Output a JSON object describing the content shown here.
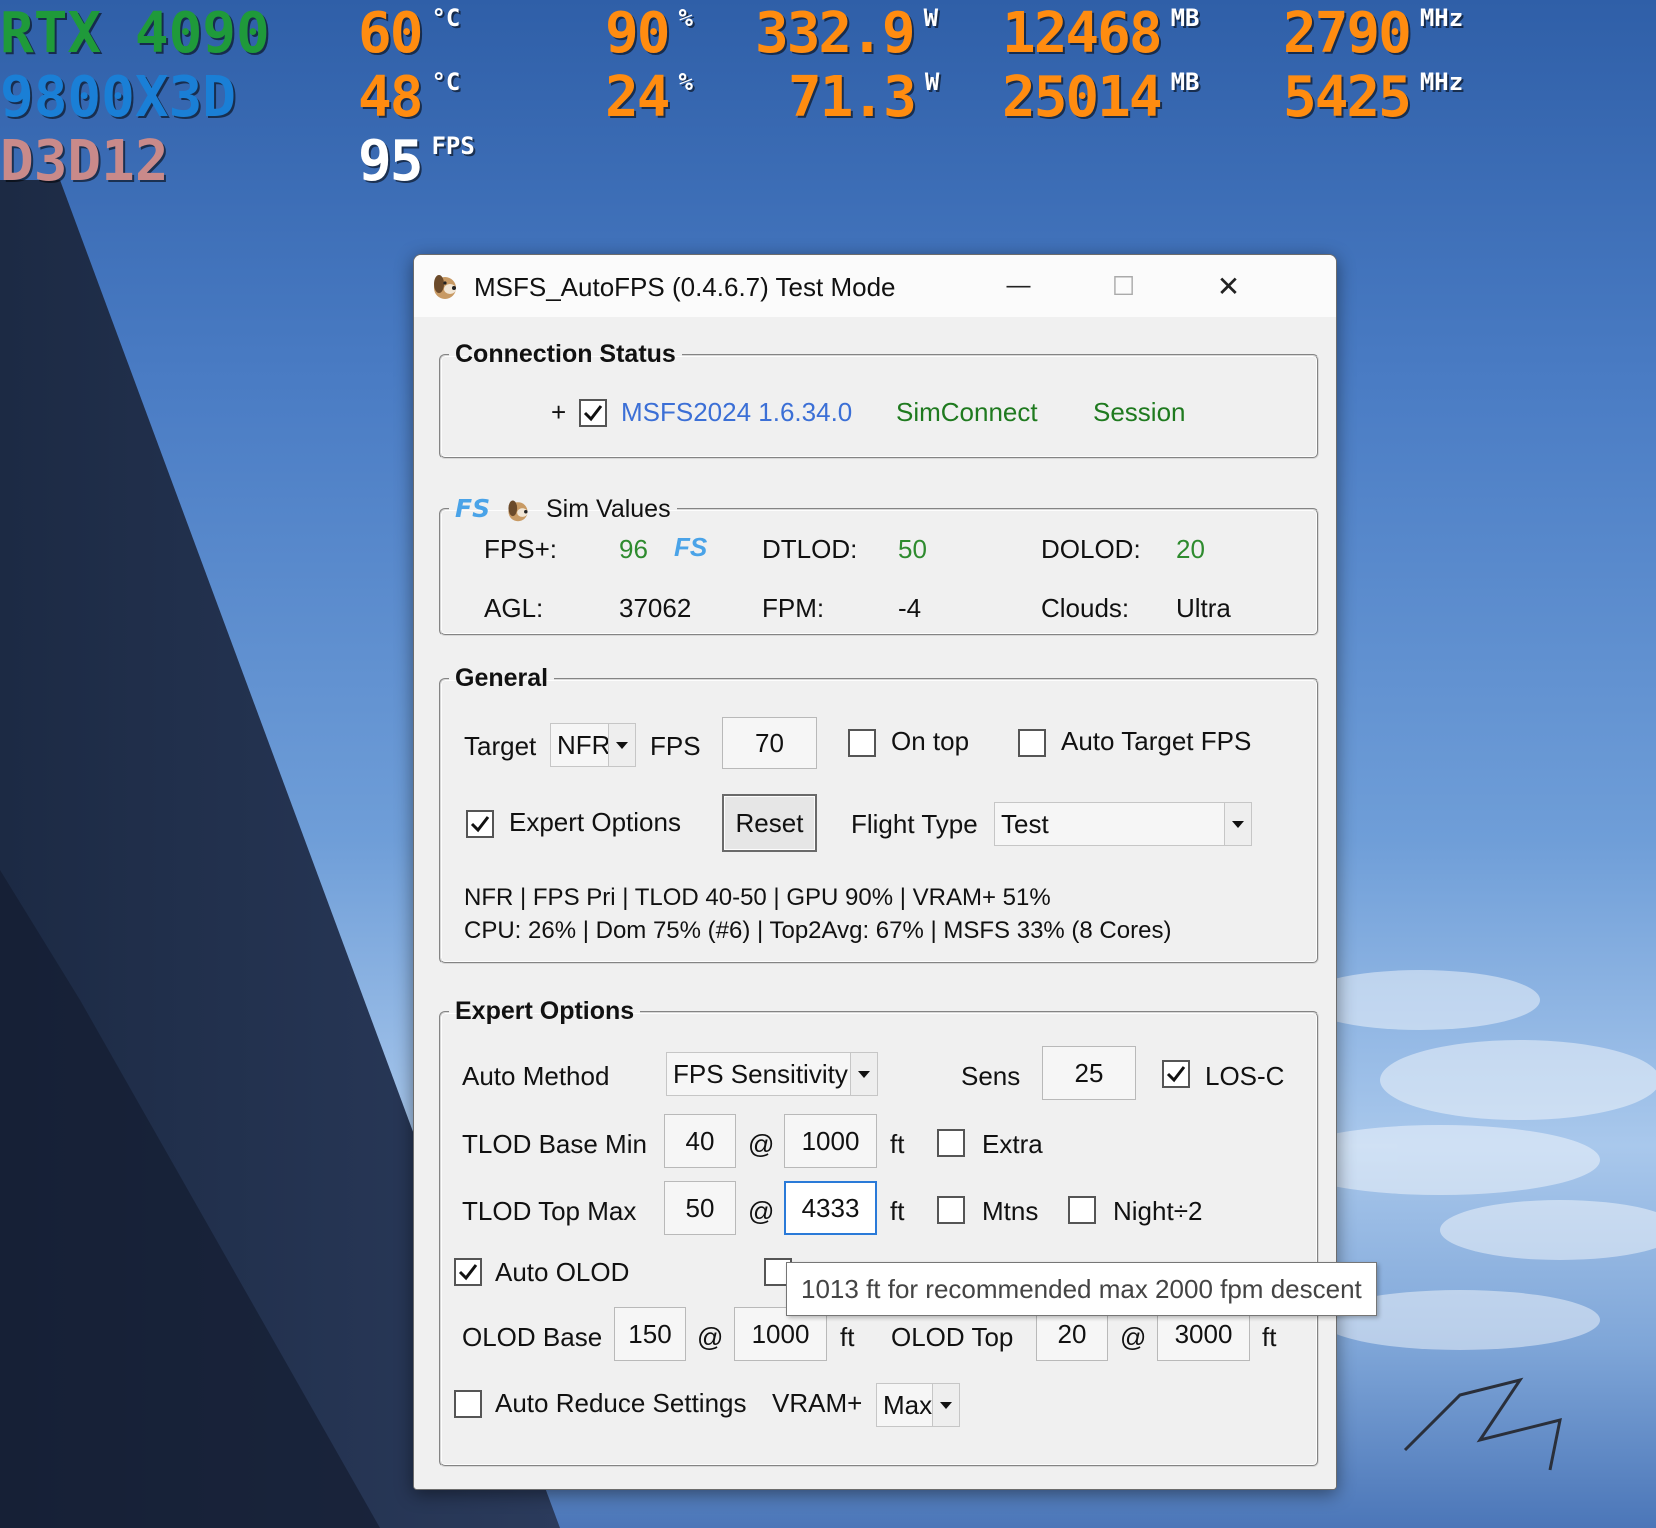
{
  "osd": {
    "gpu_name": "RTX 4090",
    "cpu_name": "9800X3D",
    "api_name": "D3D12",
    "gpu": {
      "temp": "60",
      "temp_unit": "°C",
      "load": "90",
      "load_unit": "%",
      "power": "332.9",
      "power_unit": "W",
      "mem": "12468",
      "mem_unit": "MB",
      "clock": "2790",
      "clock_unit": "MHz"
    },
    "cpu": {
      "temp": "48",
      "temp_unit": "°C",
      "load": "24",
      "load_unit": "%",
      "power": "71.3",
      "power_unit": "W",
      "mem": "25014",
      "mem_unit": "MB",
      "clock": "5425",
      "clock_unit": "MHz"
    },
    "fps": {
      "value": "95",
      "unit": "FPS"
    },
    "colors": {
      "gpu": "#1f9a3a",
      "cpu": "#1a7fd6",
      "api": "#c98a8a",
      "values": "#ff8c10",
      "fps": "#ffffff"
    }
  },
  "window": {
    "title": "MSFS_AutoFPS (0.4.6.7) Test Mode",
    "minimize": "—",
    "maximize": "☐",
    "close": "✕"
  },
  "connection": {
    "legend": "Connection Status",
    "plus": "+",
    "sim_checked": true,
    "sim_version": "MSFS2024 1.6.34.0",
    "simconnect": "SimConnect",
    "session": "Session"
  },
  "sim_values": {
    "legend": "Sim Values",
    "fps_label": "FPS+:",
    "fps_value": "96",
    "dtlod_label": "DTLOD:",
    "dtlod_value": "50",
    "dolod_label": "DOLOD:",
    "dolod_value": "20",
    "agl_label": "AGL:",
    "agl_value": "37062",
    "fpm_label": "FPM:",
    "fpm_value": "-4",
    "clouds_label": "Clouds:",
    "clouds_value": "Ultra"
  },
  "general": {
    "legend": "General",
    "target_label": "Target",
    "target_value": "NFR",
    "fps_label": "FPS",
    "fps_value": "70",
    "on_top_label": "On top",
    "on_top_checked": false,
    "auto_target_label": "Auto Target FPS",
    "auto_target_checked": false,
    "expert_label": "Expert Options",
    "expert_checked": true,
    "reset_label": "Reset",
    "flight_type_label": "Flight Type",
    "flight_type_value": "Test",
    "status_line1": "NFR | FPS Pri | TLOD 40-50 | GPU 90% | VRAM+ 51%",
    "status_line2": "CPU: 26% | Dom 75% (#6) | Top2Avg: 67% | MSFS 33% (8 Cores)"
  },
  "expert": {
    "legend": "Expert Options",
    "auto_method_label": "Auto Method",
    "auto_method_value": "FPS Sensitivity",
    "sens_label": "Sens",
    "sens_value": "25",
    "losc_label": "LOS-C",
    "losc_checked": true,
    "tlod_base_label": "TLOD Base Min",
    "tlod_base_value": "40",
    "tlod_base_alt": "1000",
    "at": "@",
    "ft": "ft",
    "extra_label": "Extra",
    "extra_checked": false,
    "tlod_top_label": "TLOD Top Max",
    "tlod_top_value": "50",
    "tlod_top_alt": "4333",
    "mtns_label": "Mtns",
    "mtns_checked": false,
    "night_label": "Night÷2",
    "night_checked": false,
    "auto_olod_label": "Auto OLOD",
    "auto_olod_checked": true,
    "olod_base_label": "OLOD Base",
    "olod_base_value": "150",
    "olod_base_alt": "1000",
    "olod_top_label": "OLOD Top",
    "olod_top_value": "20",
    "olod_top_alt": "3000",
    "auto_reduce_label": "Auto Reduce Settings",
    "auto_reduce_checked": false,
    "vram_label": "VRAM+",
    "vram_value": "Max"
  },
  "tooltip": "1013 ft for recommended max 2000 fpm descent"
}
